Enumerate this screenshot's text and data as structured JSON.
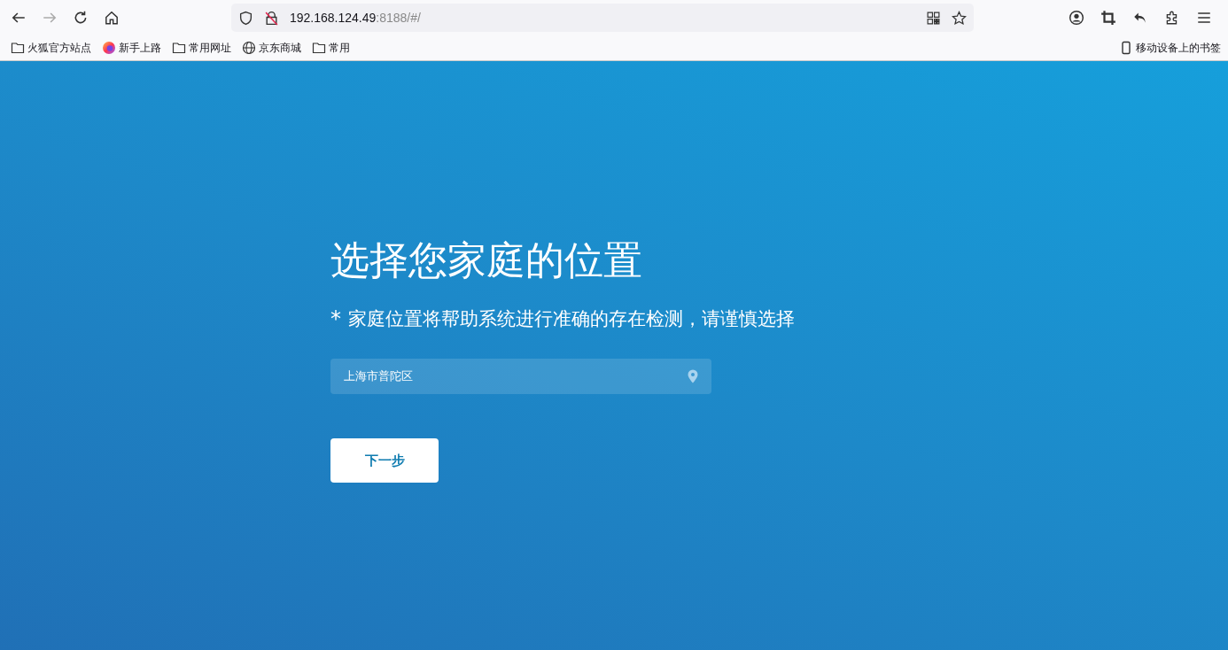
{
  "browser": {
    "url": {
      "host": "192.168.124.49",
      "rest": ":8188/#/"
    },
    "bookmarks": [
      {
        "kind": "folder",
        "label": "火狐官方站点"
      },
      {
        "kind": "firefox",
        "label": "新手上路"
      },
      {
        "kind": "folder",
        "label": "常用网址"
      },
      {
        "kind": "globe",
        "label": "京东商城"
      },
      {
        "kind": "folder",
        "label": "常用"
      }
    ],
    "mobile_bookmarks": "移动设备上的书签"
  },
  "page": {
    "title": "选择您家庭的位置",
    "note_mark": "*",
    "note": "家庭位置将帮助系统进行准确的存在检测，请谨慎选择",
    "location_field": {
      "value": "上海市普陀区"
    },
    "next_button": "下一步"
  }
}
